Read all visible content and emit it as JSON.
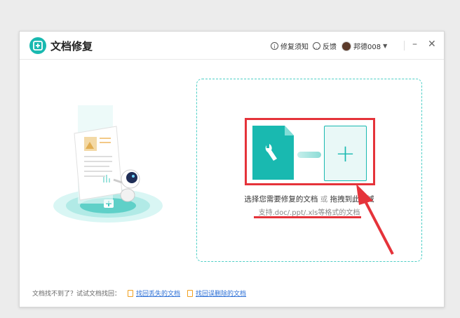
{
  "app": {
    "title": "文档修复"
  },
  "header": {
    "help_label": "修复须知",
    "feedback_label": "反馈",
    "username": "邦德008",
    "minimize_glyph": "–",
    "close_glyph": "✕"
  },
  "dropzone": {
    "select_text": "选择您需要修复的文档",
    "or_text": "或",
    "drag_text": "拖拽到此区域",
    "support_text": "支持.doc/.ppt/.xls等格式的文档",
    "plus_glyph": "+"
  },
  "footer": {
    "hint": "文档找不到了？试试文档找回：",
    "link_lost": "找回丢失的文档",
    "link_deleted": "找回误删除的文档"
  },
  "colors": {
    "accent": "#19b9b0",
    "highlight": "#e5333a",
    "link": "#2c6fd6"
  },
  "icons": [
    "app-logo-icon",
    "info-icon",
    "feedback-icon",
    "avatar",
    "wrench-icon",
    "plus-icon",
    "document-icon"
  ]
}
